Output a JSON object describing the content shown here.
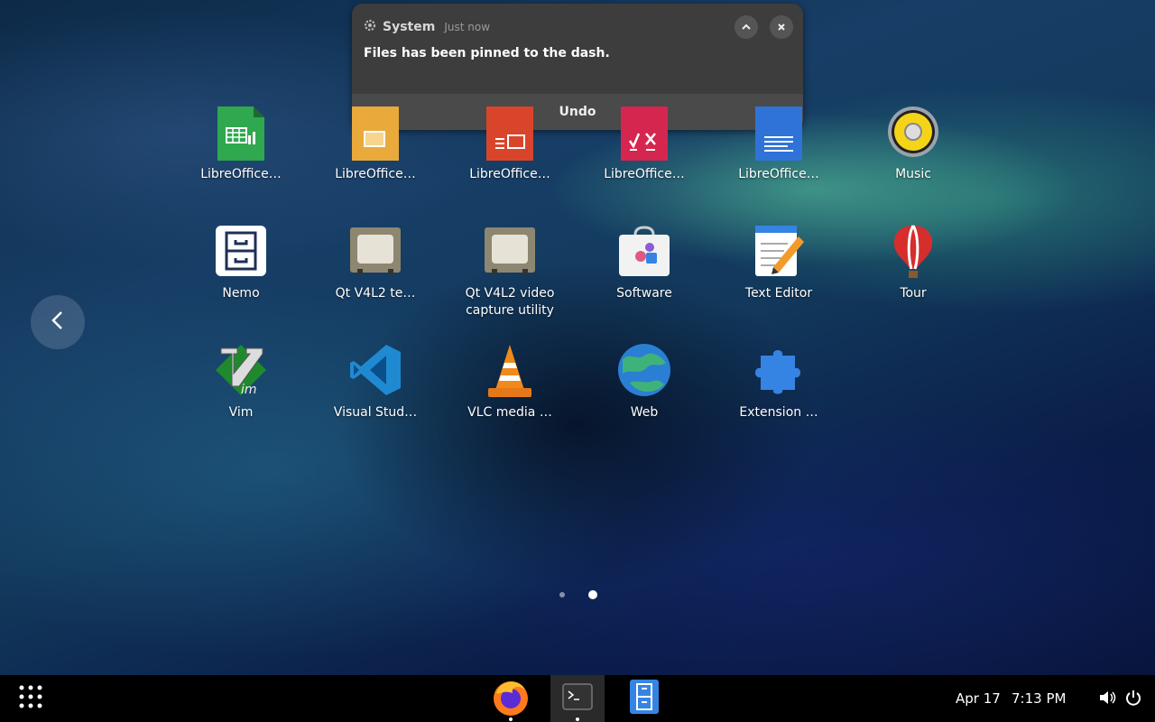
{
  "notification": {
    "app_name": "System",
    "time": "Just now",
    "message": "Files has been pinned to the dash.",
    "action_label": "Undo",
    "icon": "gear-icon"
  },
  "apps": [
    {
      "label": "LibreOffice…",
      "icon": "libreoffice-calc-icon"
    },
    {
      "label": "LibreOffice…",
      "icon": "libreoffice-draw-icon"
    },
    {
      "label": "LibreOffice…",
      "icon": "libreoffice-impress-icon"
    },
    {
      "label": "LibreOffice…",
      "icon": "libreoffice-math-icon"
    },
    {
      "label": "LibreOffice…",
      "icon": "libreoffice-writer-icon"
    },
    {
      "label": "Music",
      "icon": "music-icon"
    },
    {
      "label": "Nemo",
      "icon": "file-cabinet-icon"
    },
    {
      "label": "Qt V4L2 te…",
      "icon": "qt-v4l2-test-icon"
    },
    {
      "label": "Qt V4L2 video capture utility",
      "icon": "qt-v4l2-capture-icon"
    },
    {
      "label": "Software",
      "icon": "software-store-icon"
    },
    {
      "label": "Text Editor",
      "icon": "text-editor-icon"
    },
    {
      "label": "Tour",
      "icon": "hot-air-balloon-icon"
    },
    {
      "label": "Vim",
      "icon": "vim-icon"
    },
    {
      "label": "Visual Stud…",
      "icon": "vscode-icon"
    },
    {
      "label": "VLC media …",
      "icon": "vlc-cone-icon"
    },
    {
      "label": "Web",
      "icon": "globe-icon"
    },
    {
      "label": "Extension …",
      "icon": "puzzle-piece-icon"
    }
  ],
  "pagination": {
    "pages": 2,
    "current": 2
  },
  "dock": {
    "apps": [
      {
        "name": "Firefox",
        "icon": "firefox-icon"
      },
      {
        "name": "Terminal",
        "icon": "terminal-icon"
      },
      {
        "name": "Files",
        "icon": "files-icon"
      }
    ]
  },
  "topbar": {
    "date": "Apr 17",
    "time": "7:13 PM",
    "icons": [
      "show-apps-icon",
      "volume-icon",
      "power-icon"
    ]
  }
}
